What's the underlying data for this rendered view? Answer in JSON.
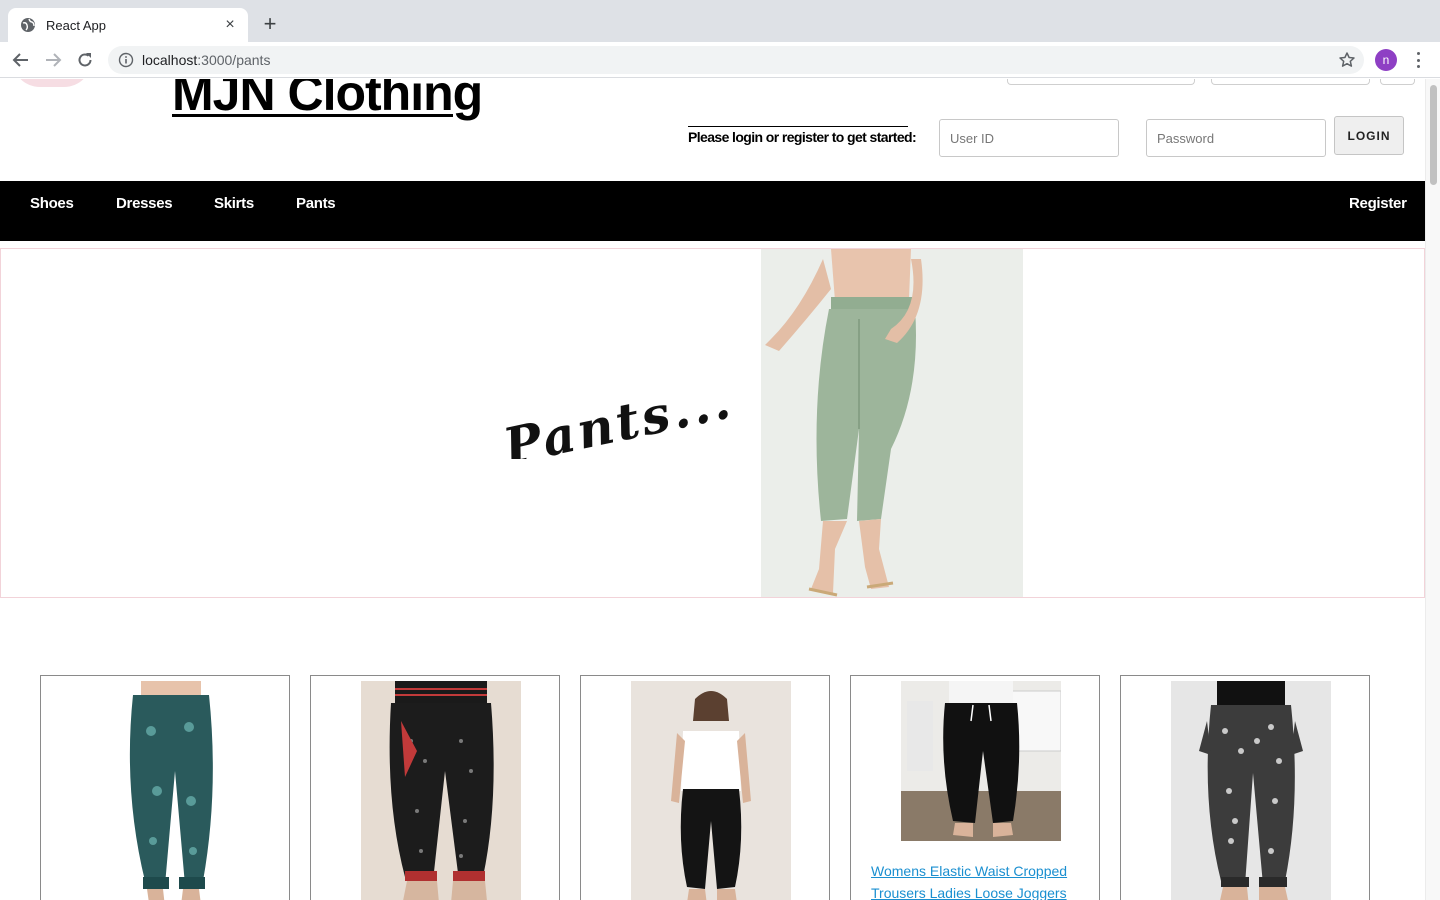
{
  "browser": {
    "tab_title": "React App",
    "url_host": "localhost",
    "url_path": ":3000/pants",
    "profile_initial": "n"
  },
  "header": {
    "site_title": "MJN Clothing",
    "login_prompt": "Please login or register to get started:",
    "user_id_placeholder": "User ID",
    "password_placeholder": "Password",
    "login_label": "LOGIN"
  },
  "nav": {
    "items": [
      "Shoes",
      "Dresses",
      "Skirts",
      "Pants"
    ],
    "register_label": "Register"
  },
  "banner": {
    "heading": "Pants..."
  },
  "products": [
    {
      "title": "",
      "pattern": "teal paisley"
    },
    {
      "title": "",
      "pattern": "black red harem"
    },
    {
      "title": "",
      "pattern": "black jogger"
    },
    {
      "title": "Womens Elastic Waist Cropped Trousers Ladies Loose Joggers",
      "pattern": "black jogger"
    },
    {
      "title": "",
      "pattern": "black white floral"
    }
  ],
  "colors": {
    "nav_bg": "#000000",
    "link": "#1a8fd0",
    "banner_border": "#f2d3d9",
    "profile": "#8e3fc4"
  }
}
